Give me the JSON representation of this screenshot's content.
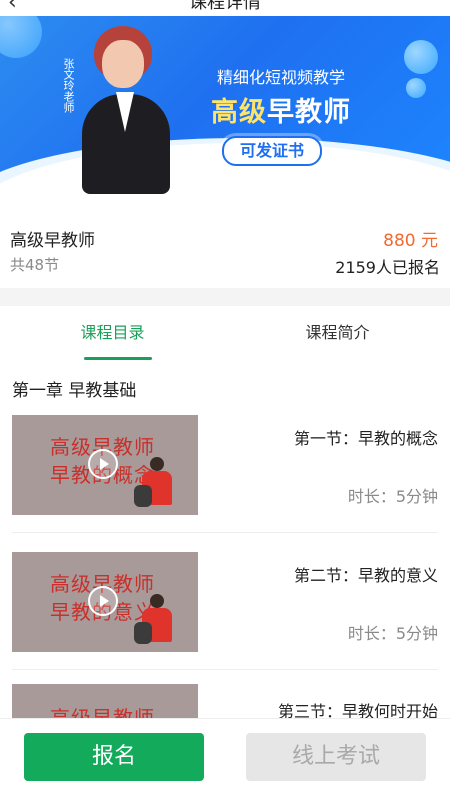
{
  "nav": {
    "title": "课程详情"
  },
  "banner": {
    "teacher_name": "张文玲老师",
    "tagline": "精细化短视频教学",
    "headline": "高级早教师",
    "certificate": "可发证书"
  },
  "course": {
    "name": "高级早教师",
    "lessons_count": "共48节",
    "price": "880 元",
    "enrolled": "2159人已报名"
  },
  "tabs": [
    {
      "label": "课程目录",
      "active": true
    },
    {
      "label": "课程简介",
      "active": false
    }
  ],
  "chapter": {
    "title": "第一章 早教基础"
  },
  "lessons": [
    {
      "title": "第一节：早教的概念",
      "duration": "时长：5分钟",
      "thumb_line1": "高级早教师",
      "thumb_line2": "早教的概念"
    },
    {
      "title": "第二节：早教的意义",
      "duration": "时长：5分钟",
      "thumb_line1": "高级早教师",
      "thumb_line2": "早教的意义"
    },
    {
      "title": "第三节：早教何时开始",
      "duration": "",
      "thumb_line1": "高级早教师",
      "thumb_line2": ""
    }
  ],
  "actions": {
    "enroll": "报名",
    "exam": "线上考试"
  },
  "colors": {
    "accent_green": "#14aa5b",
    "price_orange": "#f26a2f",
    "banner_blue": "#1f70f0"
  }
}
